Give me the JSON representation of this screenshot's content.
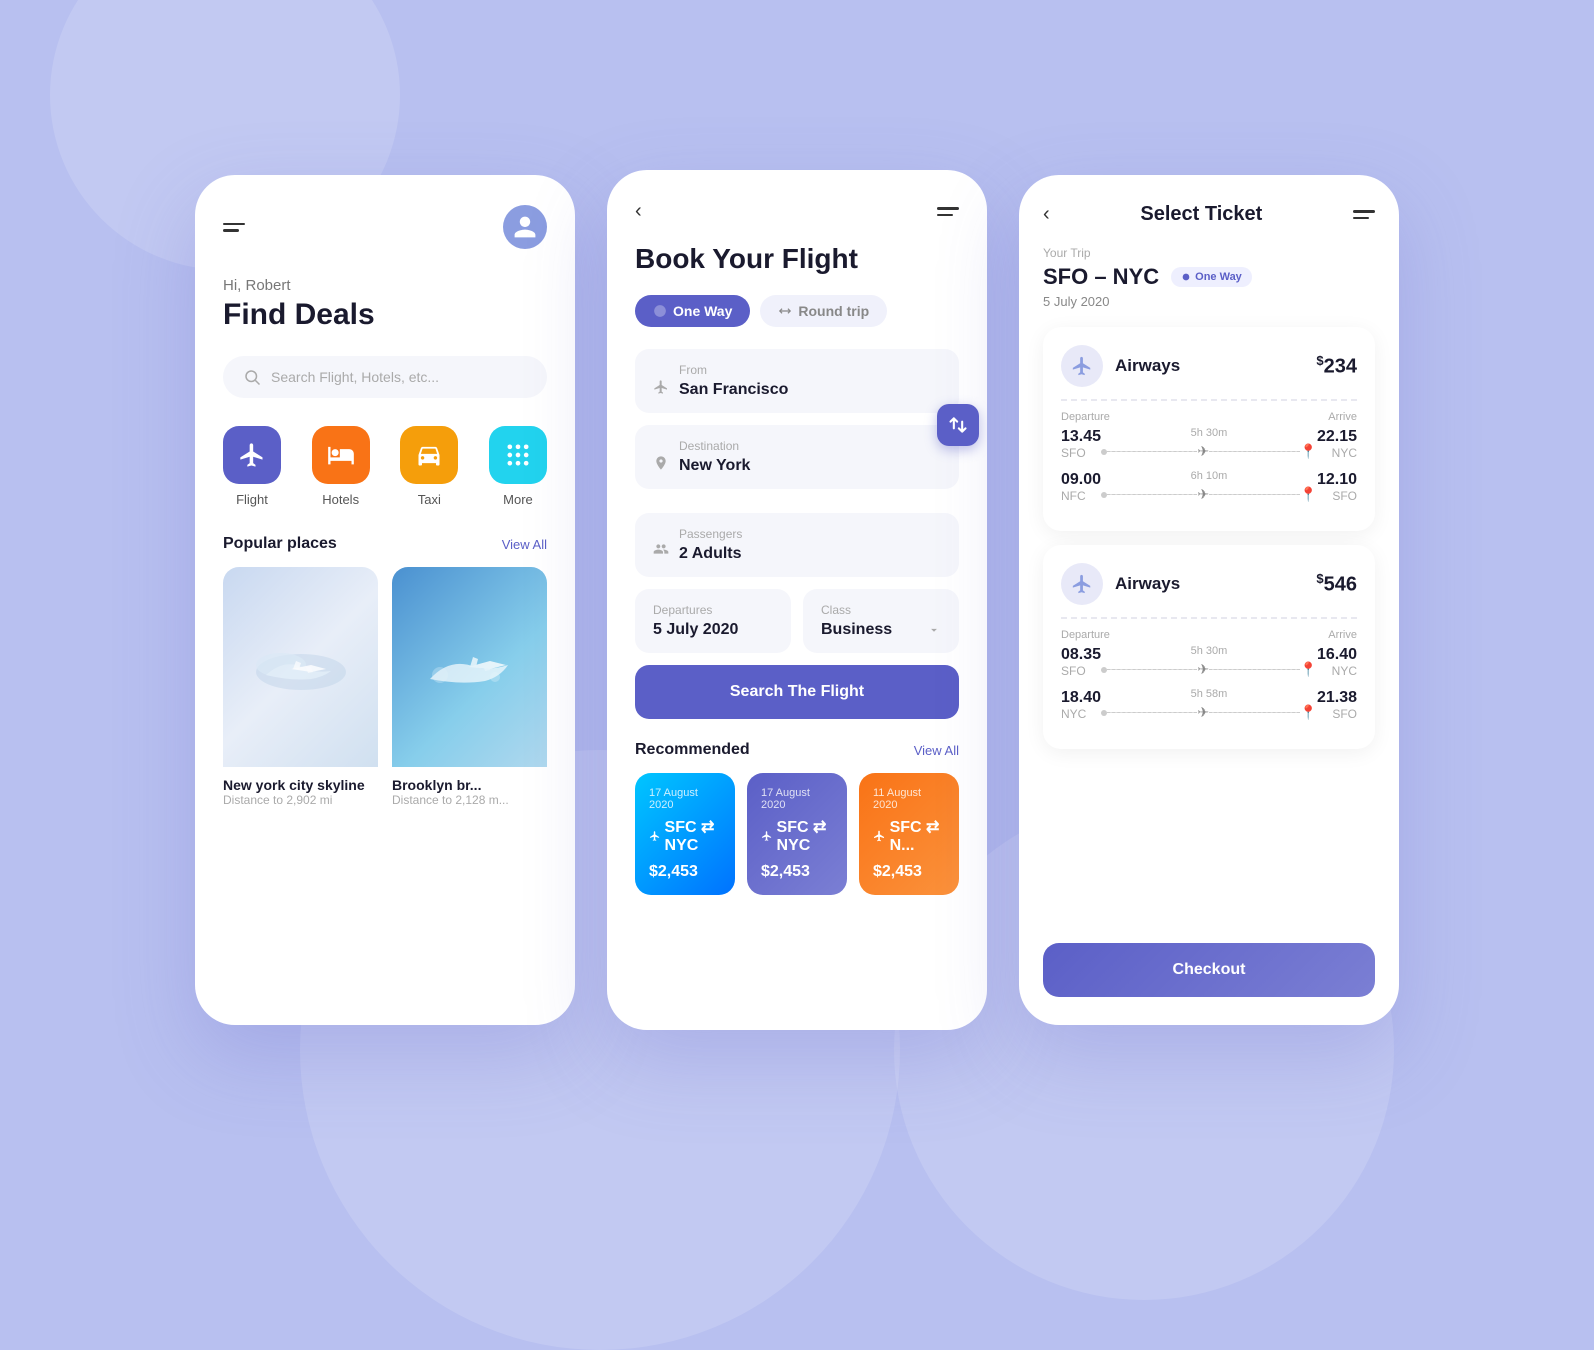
{
  "background": "#b8c0f0",
  "phone1": {
    "greeting": "Hi, Robert",
    "title": "Find Deals",
    "search_placeholder": "Search Flight, Hotels, etc...",
    "categories": [
      {
        "id": "flight",
        "label": "Flight",
        "color": "flight-color"
      },
      {
        "id": "hotels",
        "label": "Hotels",
        "color": "hotels-color"
      },
      {
        "id": "taxi",
        "label": "Taxi",
        "color": "taxi-color"
      },
      {
        "id": "more",
        "label": "More",
        "color": "more-color"
      }
    ],
    "popular_title": "Popular places",
    "view_all": "View All",
    "places": [
      {
        "name": "New york city skyline",
        "distance": "Distance to 2,902 mi"
      },
      {
        "name": "Brooklyn br...",
        "distance": "Distance to 2,128 m..."
      }
    ]
  },
  "phone2": {
    "title": "Book Your Flight",
    "trip_types": [
      {
        "label": "One Way",
        "active": true
      },
      {
        "label": "Round trip",
        "active": false
      }
    ],
    "from_label": "From",
    "from_value": "San Francisco",
    "destination_label": "Destination",
    "destination_value": "New York",
    "passengers_label": "Passengers",
    "passengers_value": "2 Adults",
    "departures_label": "Departures",
    "departures_value": "5 July 2020",
    "class_label": "Class",
    "class_value": "Business",
    "search_btn": "Search The Flight",
    "recommended_title": "Recommended",
    "view_all": "View All",
    "rec_cards": [
      {
        "date": "17 August 2020",
        "route": "SFC ⇄ NYC",
        "price": "$2,453",
        "style": "1"
      },
      {
        "date": "17 August 2020",
        "route": "SFC ⇄ NYC",
        "price": "$2,453",
        "style": "2"
      },
      {
        "date": "11 August 2020",
        "route": "SFC ⇄ N...",
        "price": "$2,453",
        "style": "3"
      }
    ]
  },
  "phone3": {
    "title": "Select Ticket",
    "your_trip_label": "Your Trip",
    "route": "SFO – NYC",
    "one_way_badge": "One Way",
    "date": "5 July 2020",
    "flight_cards": [
      {
        "airline": "Airways",
        "price": "234",
        "segments": [
          {
            "dep_label": "Departure",
            "arr_label": "Arrive",
            "dep_time": "13.45",
            "dep_airport": "SFO",
            "duration": "5h 30m",
            "arr_time": "22.15",
            "arr_airport": "NYC"
          },
          {
            "dep_time": "09.00",
            "dep_airport": "NFC",
            "duration": "6h 10m",
            "arr_time": "12.10",
            "arr_airport": "SFO"
          }
        ]
      },
      {
        "airline": "Airways",
        "price": "546",
        "segments": [
          {
            "dep_label": "Departure",
            "arr_label": "Arrive",
            "dep_time": "08.35",
            "dep_airport": "SFO",
            "duration": "5h 30m",
            "arr_time": "16.40",
            "arr_airport": "NYC"
          },
          {
            "dep_time": "18.40",
            "dep_airport": "NYC",
            "duration": "5h 58m",
            "arr_time": "21.38",
            "arr_airport": "SFO"
          }
        ]
      }
    ],
    "checkout_btn": "Checkout"
  }
}
